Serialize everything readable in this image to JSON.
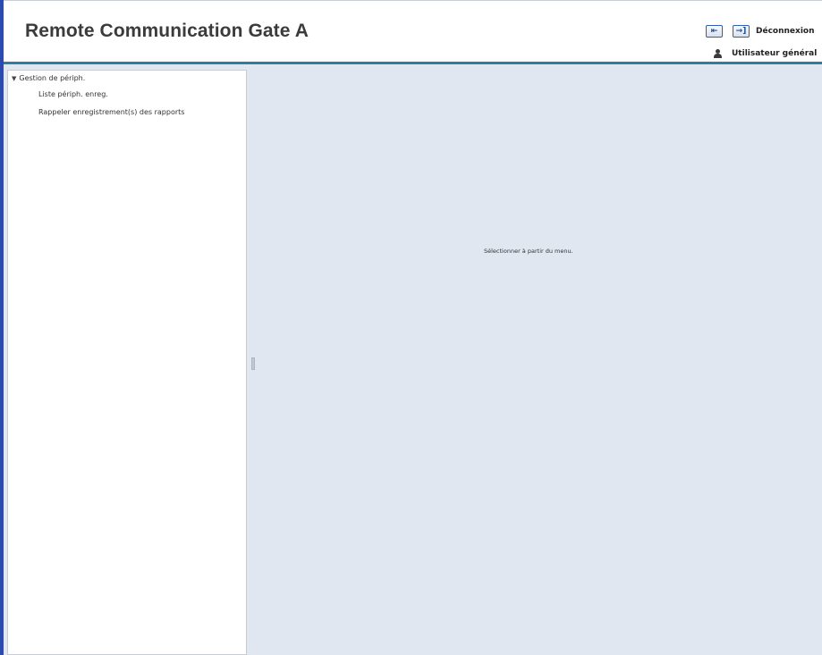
{
  "header": {
    "title": "Remote Communication Gate A",
    "back_icon_glyph": "⇤",
    "logout_icon_glyph": "→]",
    "logout_label": "Déconnexion",
    "user_label": "Utilisateur général"
  },
  "sidebar": {
    "root_label": "Gestion de périph.",
    "root_arrow": "▼",
    "items": [
      {
        "label": "Liste périph.  enreg."
      },
      {
        "label": "Rappeler enregistrement(s) des rapports"
      }
    ]
  },
  "main": {
    "hint": "Sélectionner à partir du menu."
  },
  "colors": {
    "accent_bar": "#2d7fa0",
    "left_border": "#2b4bb0",
    "content_bg": "#e0e7f1"
  },
  "icons": [
    "back-icon",
    "logout-icon",
    "user-icon",
    "expand-arrow-icon"
  ]
}
